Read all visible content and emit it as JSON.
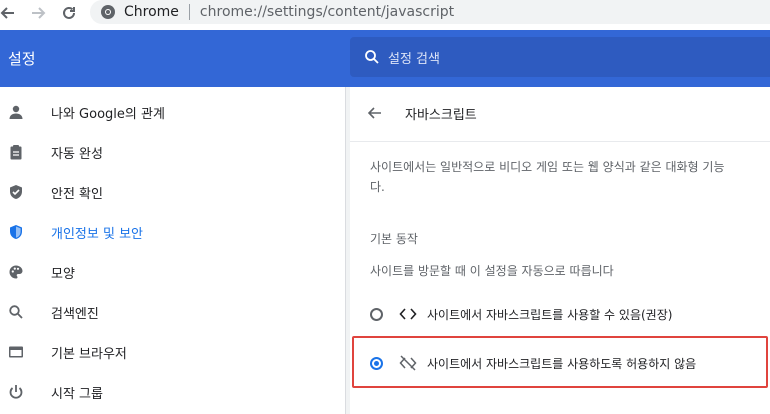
{
  "toolbar": {
    "back_icon": "arrow-left-icon",
    "forward_icon": "arrow-right-icon",
    "reload_icon": "reload-icon",
    "site_label": "Chrome",
    "url": "chrome://settings/content/javascript"
  },
  "header": {
    "title": "설정",
    "search_placeholder": "설정 검색"
  },
  "sidebar": {
    "items": [
      {
        "label": "나와 Google의 관계",
        "icon": "person-icon"
      },
      {
        "label": "자동 완성",
        "icon": "clipboard-icon"
      },
      {
        "label": "안전 확인",
        "icon": "shield-check-icon"
      },
      {
        "label": "개인정보 및 보안",
        "icon": "shield-icon"
      },
      {
        "label": "모양",
        "icon": "palette-icon"
      },
      {
        "label": "검색엔진",
        "icon": "search-icon"
      },
      {
        "label": "기본 브라우저",
        "icon": "browser-icon"
      },
      {
        "label": "시작 그룹",
        "icon": "power-icon"
      }
    ],
    "active_index": 3
  },
  "content": {
    "title": "자바스크립트",
    "description_line1": "사이트에서는 일반적으로 비디오 게임 또는 웹 양식과 같은 대화형 기능",
    "description_line2": "다.",
    "default_behavior_title": "기본 동작",
    "default_behavior_sub": "사이트를 방문할 때 이 설정을 자동으로 따릅니다",
    "options": [
      {
        "label": "사이트에서 자바스크립트를 사용할 수 있음(권장)",
        "icon": "code-icon",
        "selected": false
      },
      {
        "label": "사이트에서 자바스크립트를 사용하도록 허용하지 않음",
        "icon": "code-off-icon",
        "selected": true
      }
    ]
  },
  "colors": {
    "accent": "#1a73e8",
    "header_bg": "#3367d6",
    "highlight": "#e0443e"
  }
}
